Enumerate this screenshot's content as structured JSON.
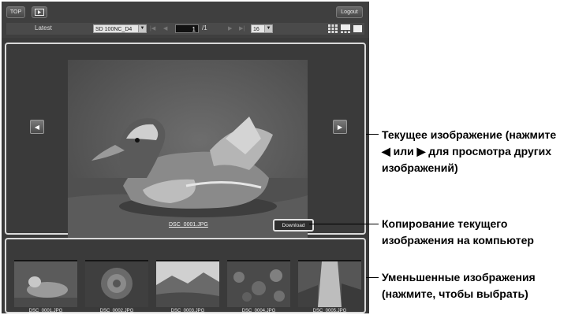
{
  "toolbar": {
    "top_label": "TOP",
    "logout_label": "Logout",
    "latest_label": "Latest",
    "folder_value": "SD  100NC_D4",
    "page_value": "1",
    "page_total": "/1",
    "per_page_value": "16"
  },
  "main": {
    "filename": "DSC_0001.JPG",
    "download_label": "Download"
  },
  "thumbnails": [
    {
      "name": "DSC_0001.JPG"
    },
    {
      "name": "DSC_0002.JPG"
    },
    {
      "name": "DSC_0003.JPG"
    },
    {
      "name": "DSC_0004.JPG"
    },
    {
      "name": "DSC_0005.JPG"
    }
  ],
  "callouts": {
    "current_image": [
      "Текущее изображение (нажмите",
      "◀ или ▶ для просмотра других",
      "изображений)"
    ],
    "copy_image": [
      "Копирование текущего",
      "изображения на компьютер"
    ],
    "thumbs": [
      "Уменьшенные изображения",
      "(нажмите, чтобы выбрать)"
    ]
  }
}
